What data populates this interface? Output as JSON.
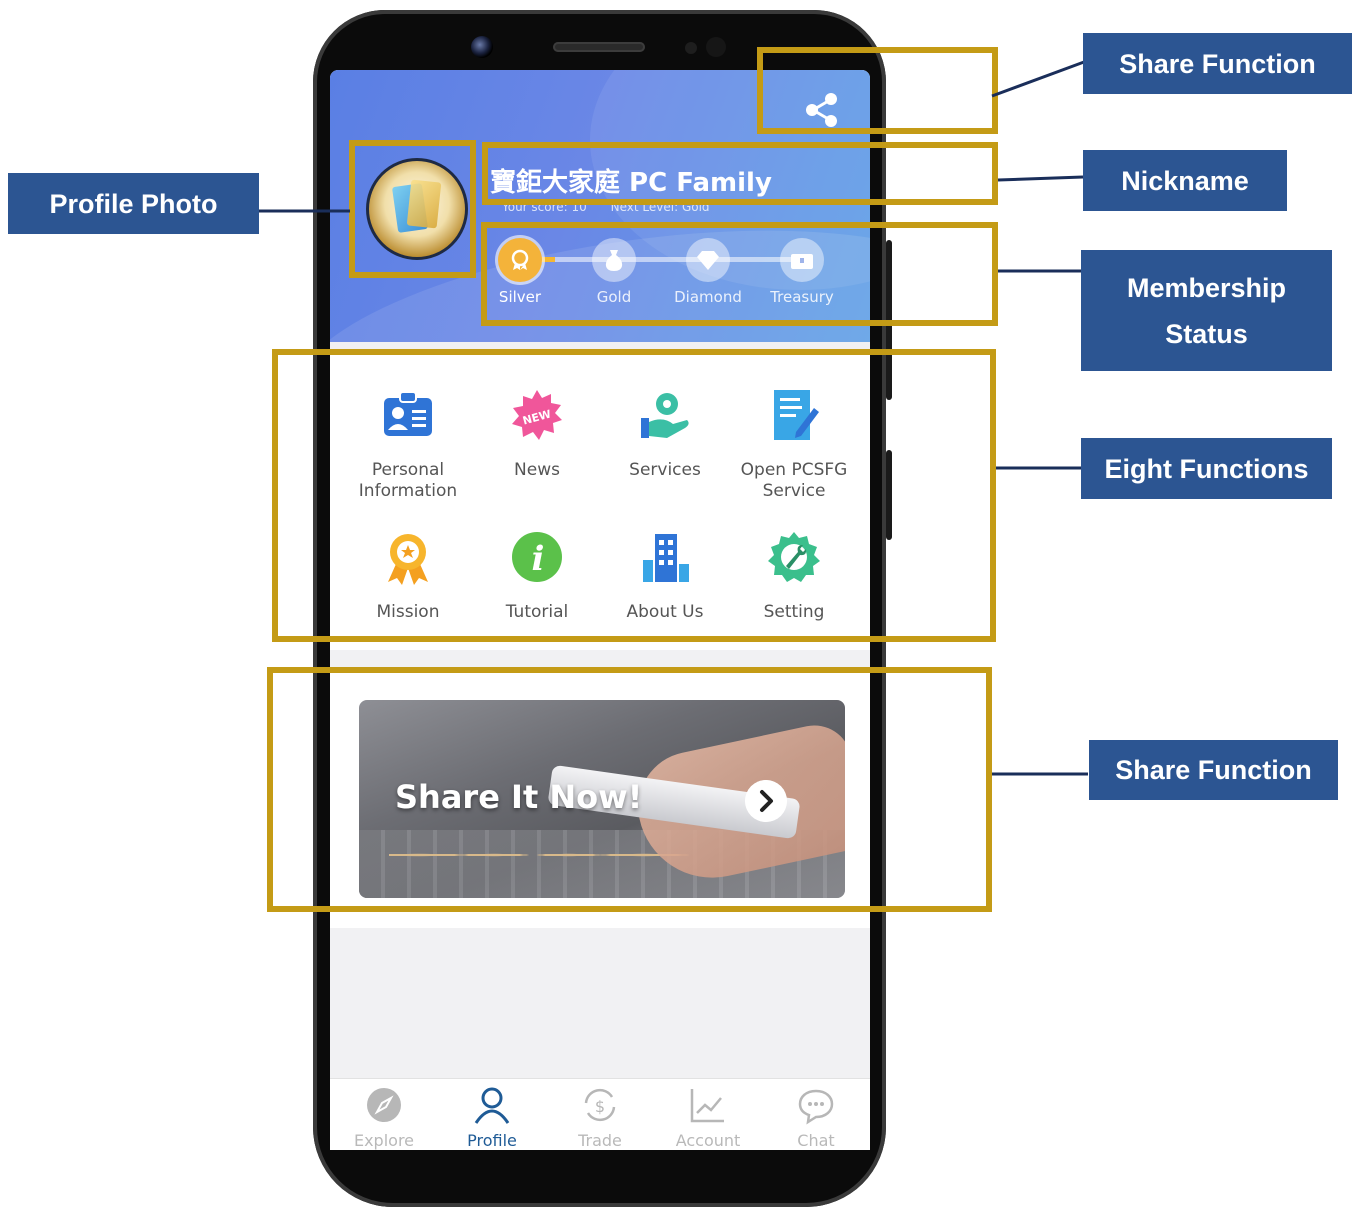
{
  "profile": {
    "nickname": "寶鉅大家庭 PC Family",
    "score_text": "Your score: 10",
    "next_level_text": "Next Level: Gold"
  },
  "membership": {
    "levels": [
      {
        "label": "Silver",
        "icon": "award-icon",
        "active": true
      },
      {
        "label": "Gold",
        "icon": "money-bag-icon",
        "active": false
      },
      {
        "label": "Diamond",
        "icon": "diamond-icon",
        "active": false
      },
      {
        "label": "Treasury",
        "icon": "treasure-chest-icon",
        "active": false
      }
    ],
    "progress": 0.12
  },
  "functions": [
    {
      "label": "Personal Information",
      "icon": "id-card-icon"
    },
    {
      "label": "News",
      "icon": "new-badge-icon"
    },
    {
      "label": "Services",
      "icon": "service-hand-gear-icon"
    },
    {
      "label": "Open PCSFG Service",
      "icon": "document-edit-icon"
    },
    {
      "label": "Mission",
      "icon": "medal-icon"
    },
    {
      "label": "Tutorial",
      "icon": "info-icon"
    },
    {
      "label": "About Us",
      "icon": "building-icon"
    },
    {
      "label": "Setting",
      "icon": "settings-wrench-icon"
    }
  ],
  "banner": {
    "text": "Share It Now!",
    "arrow_icon": "chevron-right-icon"
  },
  "bottom_nav": [
    {
      "label": "Explore",
      "icon": "compass-icon",
      "active": false
    },
    {
      "label": "Profile",
      "icon": "person-icon",
      "active": true
    },
    {
      "label": "Trade",
      "icon": "dollar-exchange-icon",
      "active": false
    },
    {
      "label": "Account",
      "icon": "line-chart-icon",
      "active": false
    },
    {
      "label": "Chat",
      "icon": "chat-bubble-icon",
      "active": false
    }
  ],
  "annotations": {
    "share_top": "Share Function",
    "profile_photo": "Profile Photo",
    "nickname": "Nickname",
    "membership_status": "Membership Status",
    "eight_functions": "Eight Functions",
    "share_banner": "Share Function"
  },
  "colors": {
    "highlight": "#c49b16",
    "callout_bg": "#2c5592",
    "header_blue": "#5a7fe4",
    "active_nav": "#1f5b96",
    "silver_active": "#f4b33a"
  }
}
